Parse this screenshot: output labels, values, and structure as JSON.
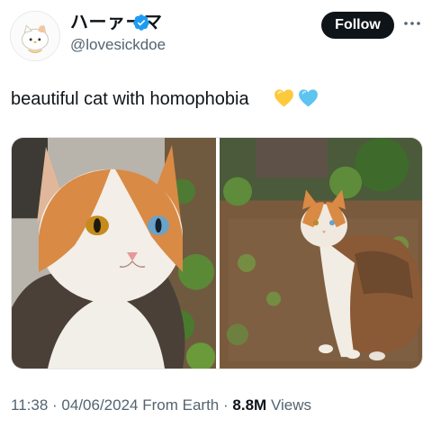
{
  "author": {
    "display_name": "ハーァーマ",
    "handle": "@lovesickdoe",
    "verified": true,
    "avatar_icon": "hello-kitty-avatar"
  },
  "follow_label": "Follow",
  "more_icon": "more-horizontal-icon",
  "tweet": {
    "text": "beautiful cat with homophobia",
    "emojis": [
      "yellow-heart",
      "blue-heart"
    ]
  },
  "media": [
    {
      "icon": "cat-photo-closeup",
      "colors": {
        "fur_orange": "#d98a45",
        "eye_left": "#c78a1c",
        "eye_right": "#6aa3c9"
      }
    },
    {
      "icon": "cat-photo-full-body",
      "colors": {
        "ground": "#7a5a3c",
        "grass": "#5e8c3a"
      }
    }
  ],
  "meta": {
    "time": "11:38",
    "date": "04/06/2024",
    "source": "From Earth",
    "views_count": "8.8M",
    "views_label": "Views",
    "sep": "·"
  },
  "colors": {
    "accent_verified": "#1d9bf0",
    "follow_bg": "#0f1419",
    "muted": "#536471"
  }
}
